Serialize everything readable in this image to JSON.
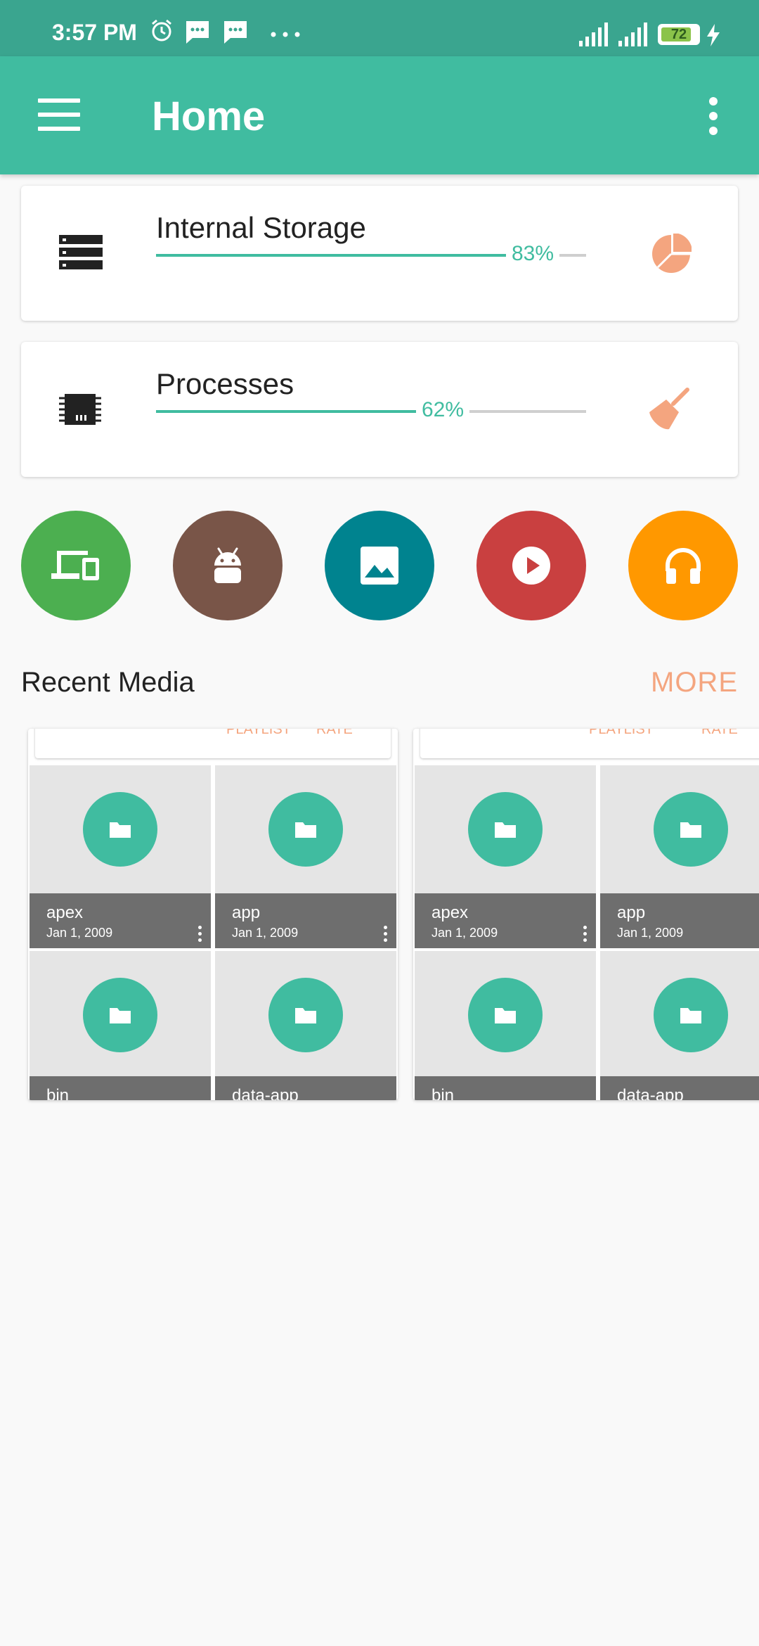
{
  "status_bar": {
    "time": "3:57 PM",
    "battery": "72",
    "icons": [
      "alarm-icon",
      "message-icon",
      "message-icon",
      "more-dots-icon",
      "signal-icon",
      "signal-icon",
      "battery-icon",
      "charging-icon"
    ]
  },
  "app_bar": {
    "title": "Home",
    "menu_icon": "hamburger-icon",
    "overflow_icon": "more-vert-icon"
  },
  "storage_cards": [
    {
      "title": "Internal Storage",
      "percent_label": "83%",
      "percent": 83,
      "icon": "storage-icon",
      "action_icon": "pie-chart-icon"
    },
    {
      "title": "Processes",
      "percent_label": "62%",
      "percent": 62,
      "icon": "memory-chip-icon",
      "action_icon": "broom-icon"
    }
  ],
  "categories": [
    {
      "icon": "devices-icon",
      "color": "#4caf50"
    },
    {
      "icon": "android-icon",
      "color": "#795548"
    },
    {
      "icon": "image-icon",
      "color": "#00838f"
    },
    {
      "icon": "play-icon",
      "color": "#c94040"
    },
    {
      "icon": "headphones-icon",
      "color": "#ff9800"
    }
  ],
  "recent_media": {
    "title": "Recent Media",
    "more_label": "MORE",
    "panels": [
      {
        "header": [
          "PLAYLIST",
          "RATE"
        ],
        "items": [
          {
            "name": "apex",
            "date": "Jan 1, 2009"
          },
          {
            "name": "app",
            "date": "Jan 1, 2009"
          },
          {
            "name": "bin",
            "date": ""
          },
          {
            "name": "data-app",
            "date": ""
          }
        ]
      },
      {
        "header": [
          "PLAYLIST",
          "RATE"
        ],
        "items": [
          {
            "name": "apex",
            "date": "Jan 1, 2009"
          },
          {
            "name": "app",
            "date": "Jan 1, 2009"
          },
          {
            "name": "bin",
            "date": ""
          },
          {
            "name": "data-app",
            "date": ""
          }
        ]
      }
    ]
  },
  "colors": {
    "primary": "#40bca0",
    "status_bar": "#3aa58f",
    "accent": "#f4a57f",
    "background": "#f9f9f9"
  }
}
